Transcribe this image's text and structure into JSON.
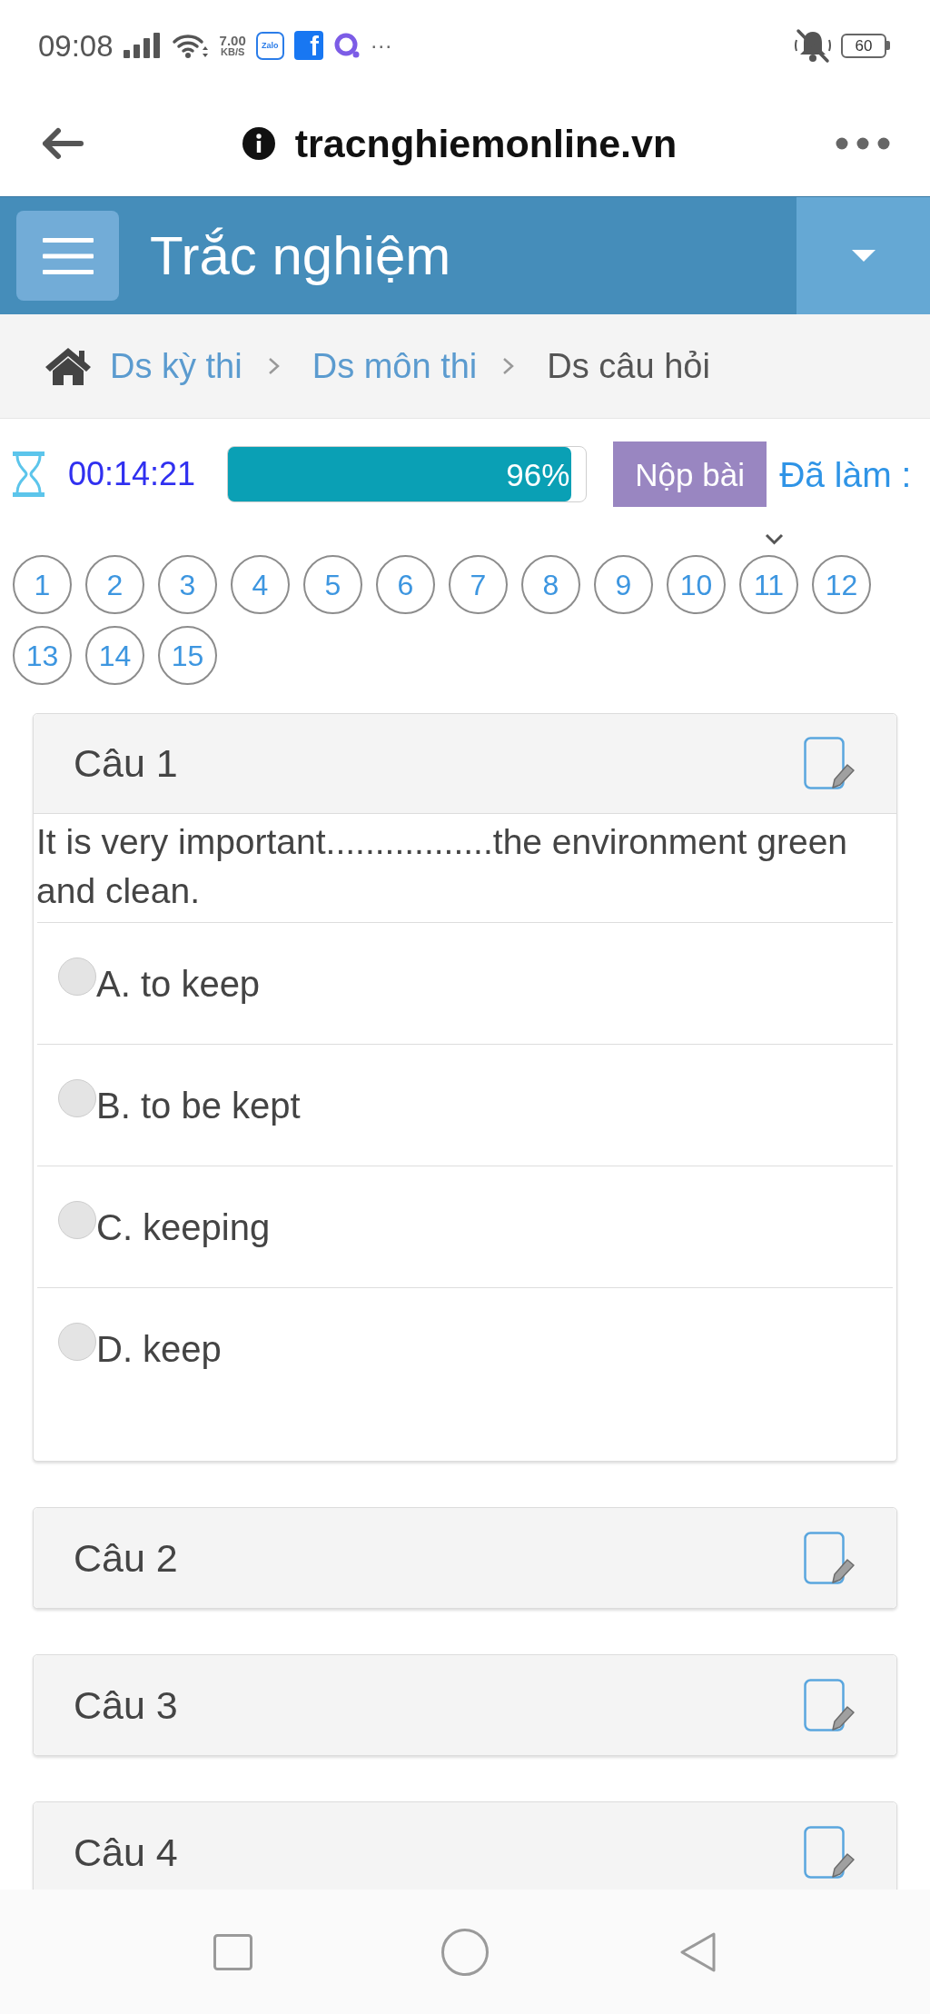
{
  "status_bar": {
    "time": "09:08",
    "speed": "7.00",
    "speed_unit": "KB/S",
    "notifications": [
      {
        "kind": "chat",
        "label": "Zalo"
      },
      {
        "kind": "social",
        "label": "f"
      },
      {
        "kind": "ring"
      }
    ],
    "more": "···",
    "battery": "60"
  },
  "address_bar": {
    "url": "tracnghiemonline.vn"
  },
  "header": {
    "title": "Trắc nghiệm"
  },
  "breadcrumb": [
    {
      "label": "Ds kỳ thi",
      "kind": "link"
    },
    {
      "label": "Ds môn thi",
      "kind": "link"
    },
    {
      "label": "Ds câu hỏi",
      "kind": "current"
    }
  ],
  "exam_bar": {
    "timer": "00:14:21",
    "progress": {
      "level": 0.96,
      "reading": "96%"
    },
    "submit_button": "Nộp bài",
    "answered_label": "Đã làm :"
  },
  "question_numbers": [
    {
      "label": "1",
      "marked": false
    },
    {
      "label": "2",
      "marked": false
    },
    {
      "label": "3",
      "marked": false
    },
    {
      "label": "4",
      "marked": false
    },
    {
      "label": "5",
      "marked": false
    },
    {
      "label": "6",
      "marked": false
    },
    {
      "label": "7",
      "marked": false
    },
    {
      "label": "8",
      "marked": false
    },
    {
      "label": "9",
      "marked": false
    },
    {
      "label": "10",
      "marked": false
    },
    {
      "label": "11",
      "marked": true
    },
    {
      "label": "12",
      "marked": false
    },
    {
      "label": "13",
      "marked": false
    },
    {
      "label": "14",
      "marked": false
    },
    {
      "label": "15",
      "marked": false
    }
  ],
  "questions": [
    {
      "title": "Câu 1",
      "expanded": true,
      "text": "It is very important.................the environment green and clean.",
      "options": [
        {
          "label": "A. to keep",
          "selected": false
        },
        {
          "label": "B. to be kept",
          "selected": false
        },
        {
          "label": "C. keeping",
          "selected": false
        },
        {
          "label": "D. keep",
          "selected": false
        }
      ]
    },
    {
      "title": "Câu 2",
      "expanded": false
    },
    {
      "title": "Câu 3",
      "expanded": false
    },
    {
      "title": "Câu 4",
      "expanded": false
    }
  ]
}
